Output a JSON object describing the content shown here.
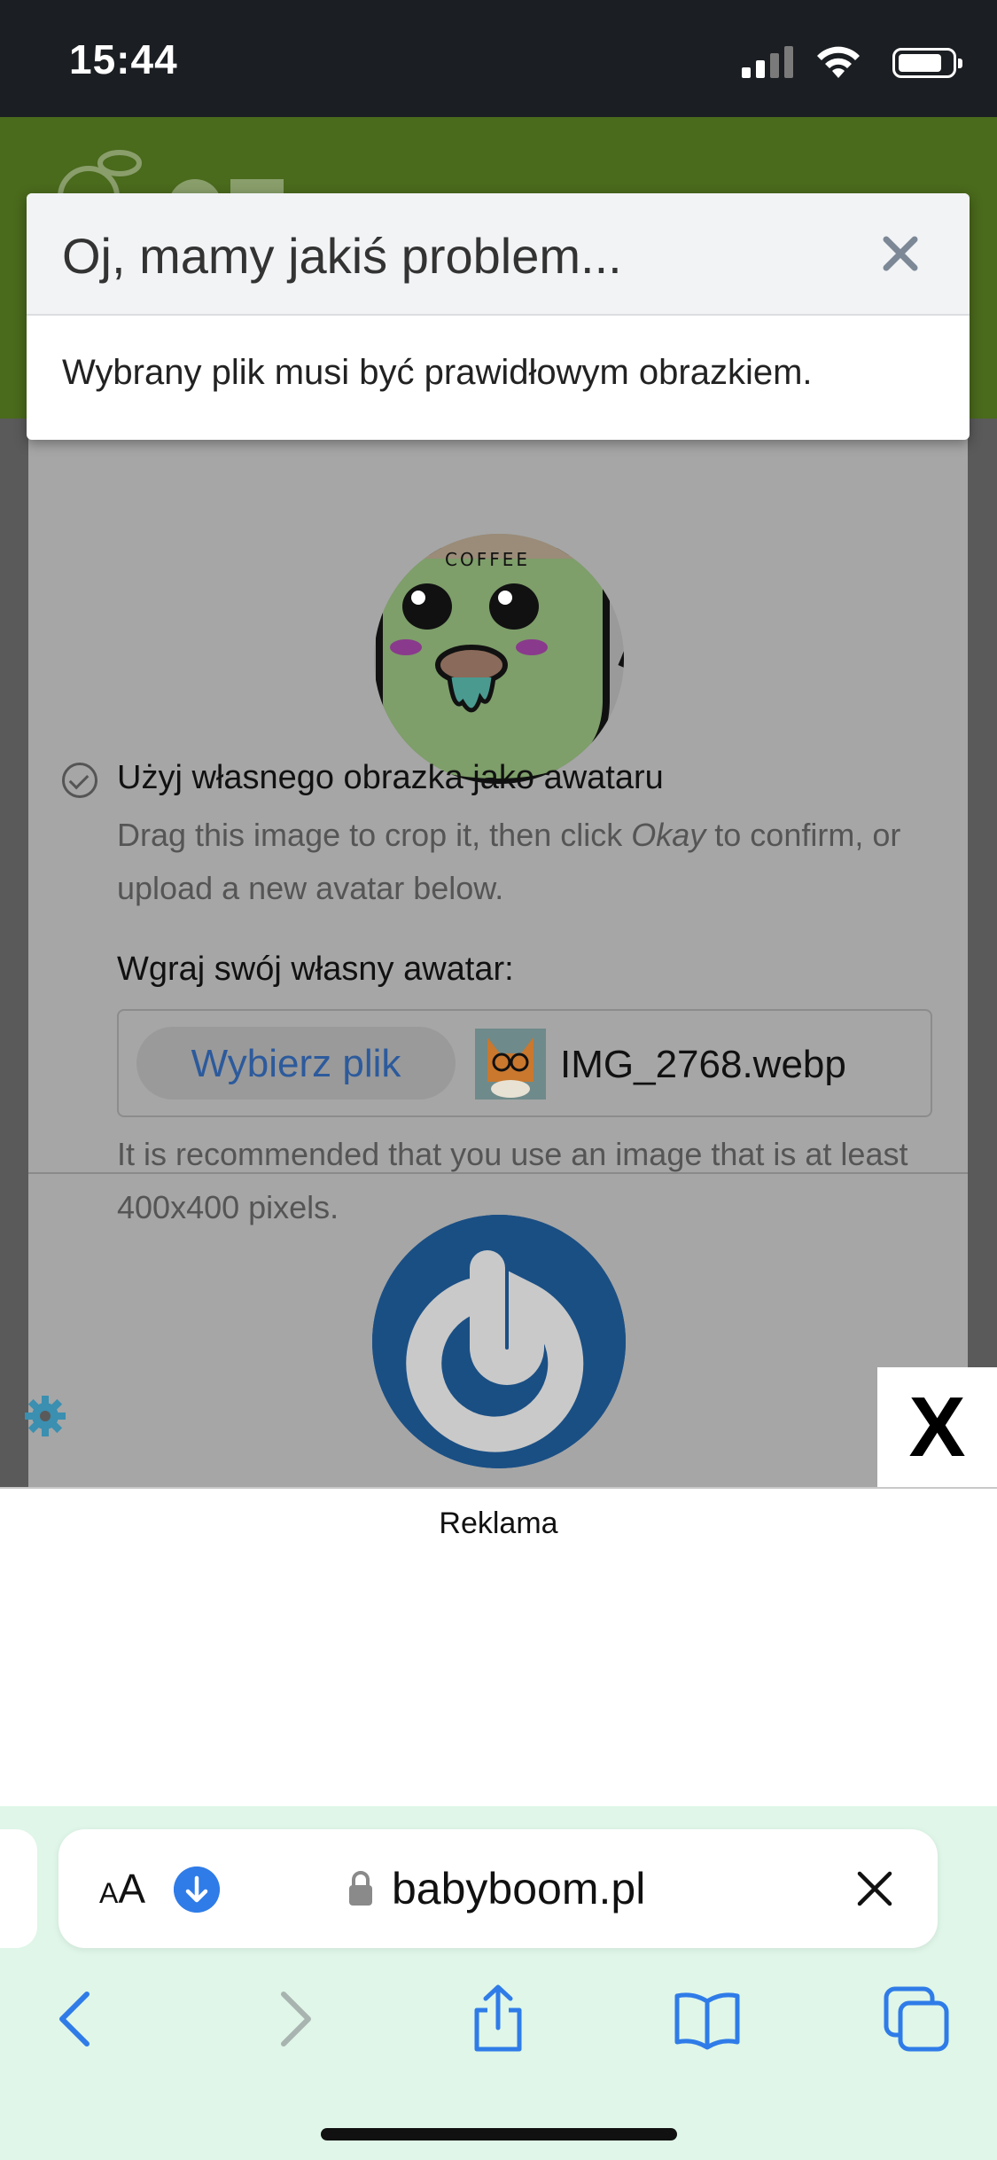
{
  "status_bar": {
    "time": "15:44"
  },
  "modal": {
    "title": "Oj, mamy jakiś problem...",
    "message": "Wybrany plik musi być prawidłowym obrazkiem."
  },
  "avatar_form": {
    "use_own_label": "Użyj własnego obrazka jako awataru",
    "drag_help_before": "Drag this image to crop it, then click ",
    "drag_help_emphasis": "Okay",
    "drag_help_after": " to confirm, or upload a new avatar below.",
    "upload_label": "Wgraj swój własny awatar:",
    "choose_file_label": "Wybierz plik",
    "selected_file": "IMG_2768.webp",
    "recommendation": "It is recommended that you use an image that is at least 400x400 pixels.",
    "mug_text": "COFFEE"
  },
  "ad": {
    "label": "Reklama",
    "close_label": "X"
  },
  "browser": {
    "aa_large": "A",
    "aa_small": "A",
    "url": "babyboom.pl"
  },
  "colors": {
    "status_bar_bg": "#1b1e22",
    "site_header_green": "#4a6a1c",
    "link_blue": "#2c5a9c",
    "browser_chrome_bg": "#dff6e8",
    "toolbar_icon_blue": "#2f7ce8"
  }
}
